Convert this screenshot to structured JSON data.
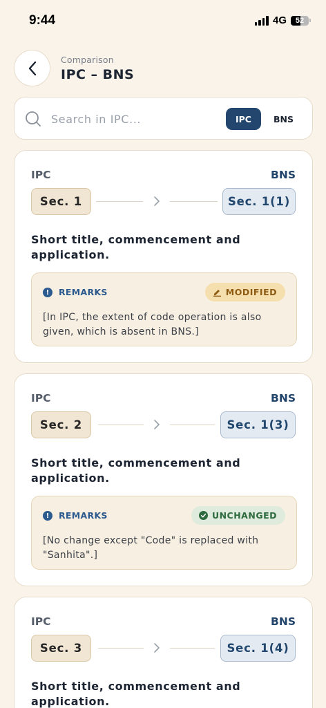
{
  "status_bar": {
    "time": "9:44",
    "network": "4G",
    "battery": "52",
    "battery_level": 0.52
  },
  "header": {
    "subtitle": "Comparison",
    "title": "IPC – BNS"
  },
  "search": {
    "placeholder": "Search in IPC...",
    "value": "",
    "toggle_ipc": "IPC",
    "toggle_bns": "BNS",
    "selected": "IPC"
  },
  "colors": {
    "background": "#f9f3ea",
    "accent": "#22466d",
    "modified": "#8d5b12",
    "unchanged": "#2e6b3e"
  },
  "cards": [
    {
      "ipc_label": "IPC",
      "bns_label": "BNS",
      "ipc_section": "Sec. 1",
      "bns_section": "Sec. 1(1)",
      "title": "Short title, commencement and application.",
      "remarks_label": "REMARKS",
      "status": "MODIFIED",
      "status_icon": "pencil-icon",
      "remarks": "[In IPC, the extent of code operation is also given, which is absent in BNS.]"
    },
    {
      "ipc_label": "IPC",
      "bns_label": "BNS",
      "ipc_section": "Sec. 2",
      "bns_section": "Sec. 1(3)",
      "title": "Short title, commencement and application.",
      "remarks_label": "REMARKS",
      "status": "UNCHANGED",
      "status_icon": "check-circle-icon",
      "remarks": "[No change except \"Code\" is replaced with \"Sanhita\".]"
    },
    {
      "ipc_label": "IPC",
      "bns_label": "BNS",
      "ipc_section": "Sec. 3",
      "bns_section": "Sec. 1(4)",
      "title": "Short title, commencement and application."
    }
  ]
}
